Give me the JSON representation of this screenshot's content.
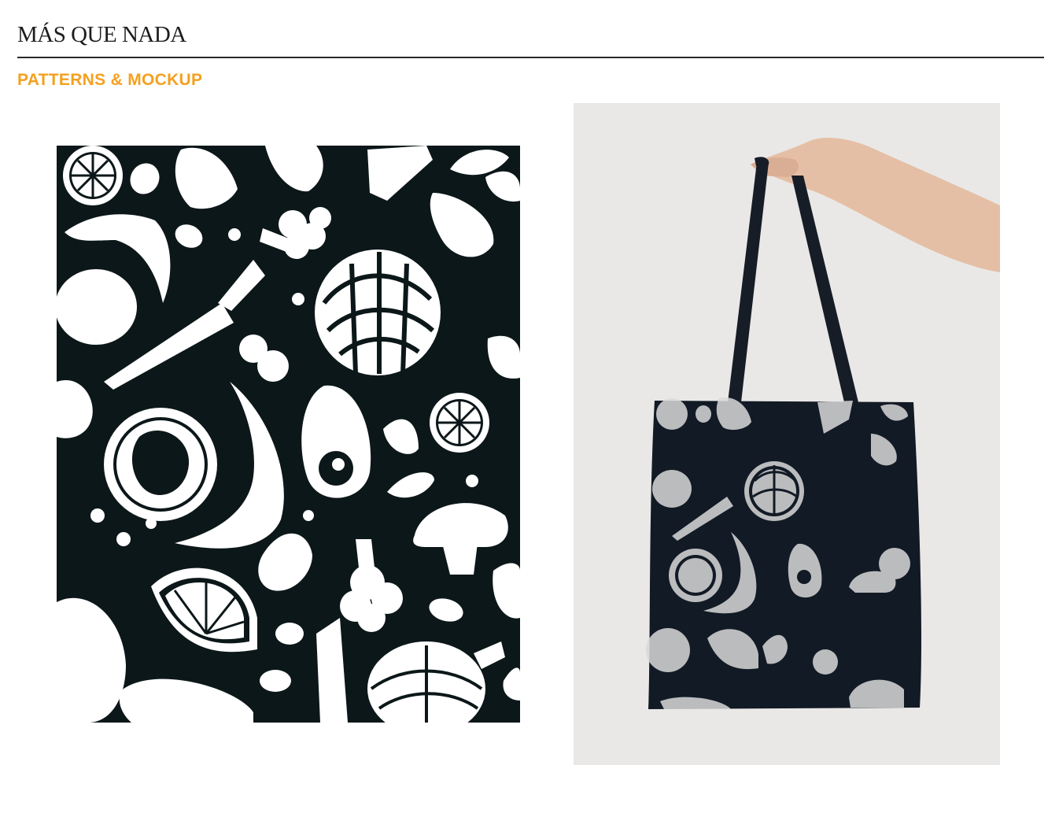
{
  "header": {
    "brand": "MÁS QUE NADA"
  },
  "section": {
    "title": "PATTERNS & MOCKUP"
  },
  "colors": {
    "accent": "#f5a01f",
    "pattern_background": "#0c1719",
    "pattern_ink": "#ffffff",
    "bag_fabric": "#121a25",
    "mockup_background": "#e9e8e6"
  },
  "images": {
    "pattern": "food-pattern-illustration",
    "mockup": "tote-bag-mockup-photo"
  }
}
